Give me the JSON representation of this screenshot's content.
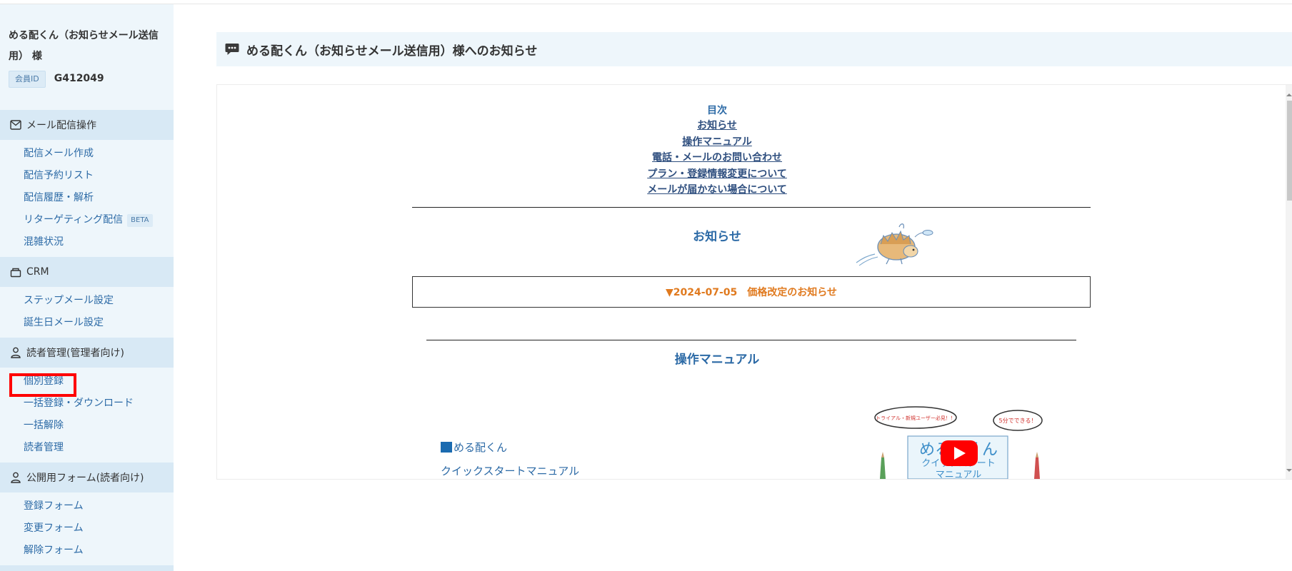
{
  "account": {
    "name": "める配くん（お知らせメール送信用） 様",
    "member_label": "会員ID",
    "member_id": "G412049"
  },
  "sidebar": {
    "sections": [
      {
        "title": "メール配信操作",
        "icon": "mail-icon",
        "items": [
          {
            "label": "配信メール作成"
          },
          {
            "label": "配信予約リスト"
          },
          {
            "label": "配信履歴・解析"
          },
          {
            "label": "リターゲティング配信",
            "badge": "BETA"
          },
          {
            "label": "混雑状況"
          }
        ]
      },
      {
        "title": "CRM",
        "icon": "crm-box-icon",
        "items": [
          {
            "label": "ステップメール設定"
          },
          {
            "label": "誕生日メール設定"
          }
        ]
      },
      {
        "title": "読者管理(管理者向け)",
        "icon": "user-icon",
        "items": [
          {
            "label": "個別登録",
            "highlighted": true
          },
          {
            "label": "一括登録・ダウンロード"
          },
          {
            "label": "一括解除"
          },
          {
            "label": "読者管理"
          }
        ]
      },
      {
        "title": "公開用フォーム(読者向け)",
        "icon": "user-icon",
        "items": [
          {
            "label": "登録フォーム"
          },
          {
            "label": "変更フォーム"
          },
          {
            "label": "解除フォーム"
          }
        ]
      }
    ]
  },
  "main": {
    "header_title": "める配くん（お知らせメール送信用）様へのお知らせ",
    "toc": {
      "title": "目次",
      "links": [
        "お知らせ",
        "操作マニュアル",
        "電話・メールのお問い合わせ",
        "プラン・登録情報変更について",
        "メールが届かない場合について"
      ]
    },
    "notices_title": "お知らせ",
    "notice_link": "▼2024-07-05　価格改定のお知らせ",
    "manual_title": "操作マニュアル",
    "manual_link_1": "める配くん",
    "manual_link_2": "クイックスタートマニュアル",
    "video_thumb": {
      "bubble_left": "トライアル・新規ユーザー必見！！",
      "bubble_right": "5分でできる！",
      "title": "める配くん",
      "subtitle": "クイックスタート",
      "subtitle2": "マニュアル"
    }
  },
  "colors": {
    "sidebar_bg": "#eef6fb",
    "section_bg": "#d8e9f5",
    "link": "#2c6aa6",
    "notice_orange": "#e07a1f",
    "highlight": "#ff0000"
  }
}
